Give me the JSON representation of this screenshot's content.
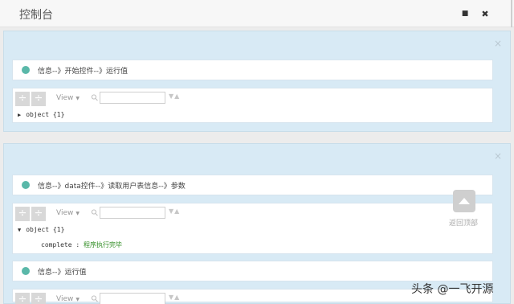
{
  "header": {
    "title": "控制台",
    "stop_icon": "■",
    "close_icon": "✖"
  },
  "panels": [
    {
      "close_label": "×",
      "info": "信息--》开始控件--》运行值",
      "tool": {
        "view_label": "View",
        "object_label": "object {1}",
        "expanded": false
      }
    },
    {
      "close_label": "×",
      "info1": "信息--》data控件--》读取用户表信息--》参数",
      "tool1": {
        "view_label": "View",
        "object_label": "object {1}",
        "expanded": true,
        "prop_key": "complete",
        "prop_value": "程序执行完毕"
      },
      "info2": "信息--》运行值",
      "tool2": {
        "view_label": "View"
      }
    }
  ],
  "back_to_top": {
    "label": "返回顶部"
  },
  "watermark": {
    "text": "头条 @一飞开源"
  }
}
